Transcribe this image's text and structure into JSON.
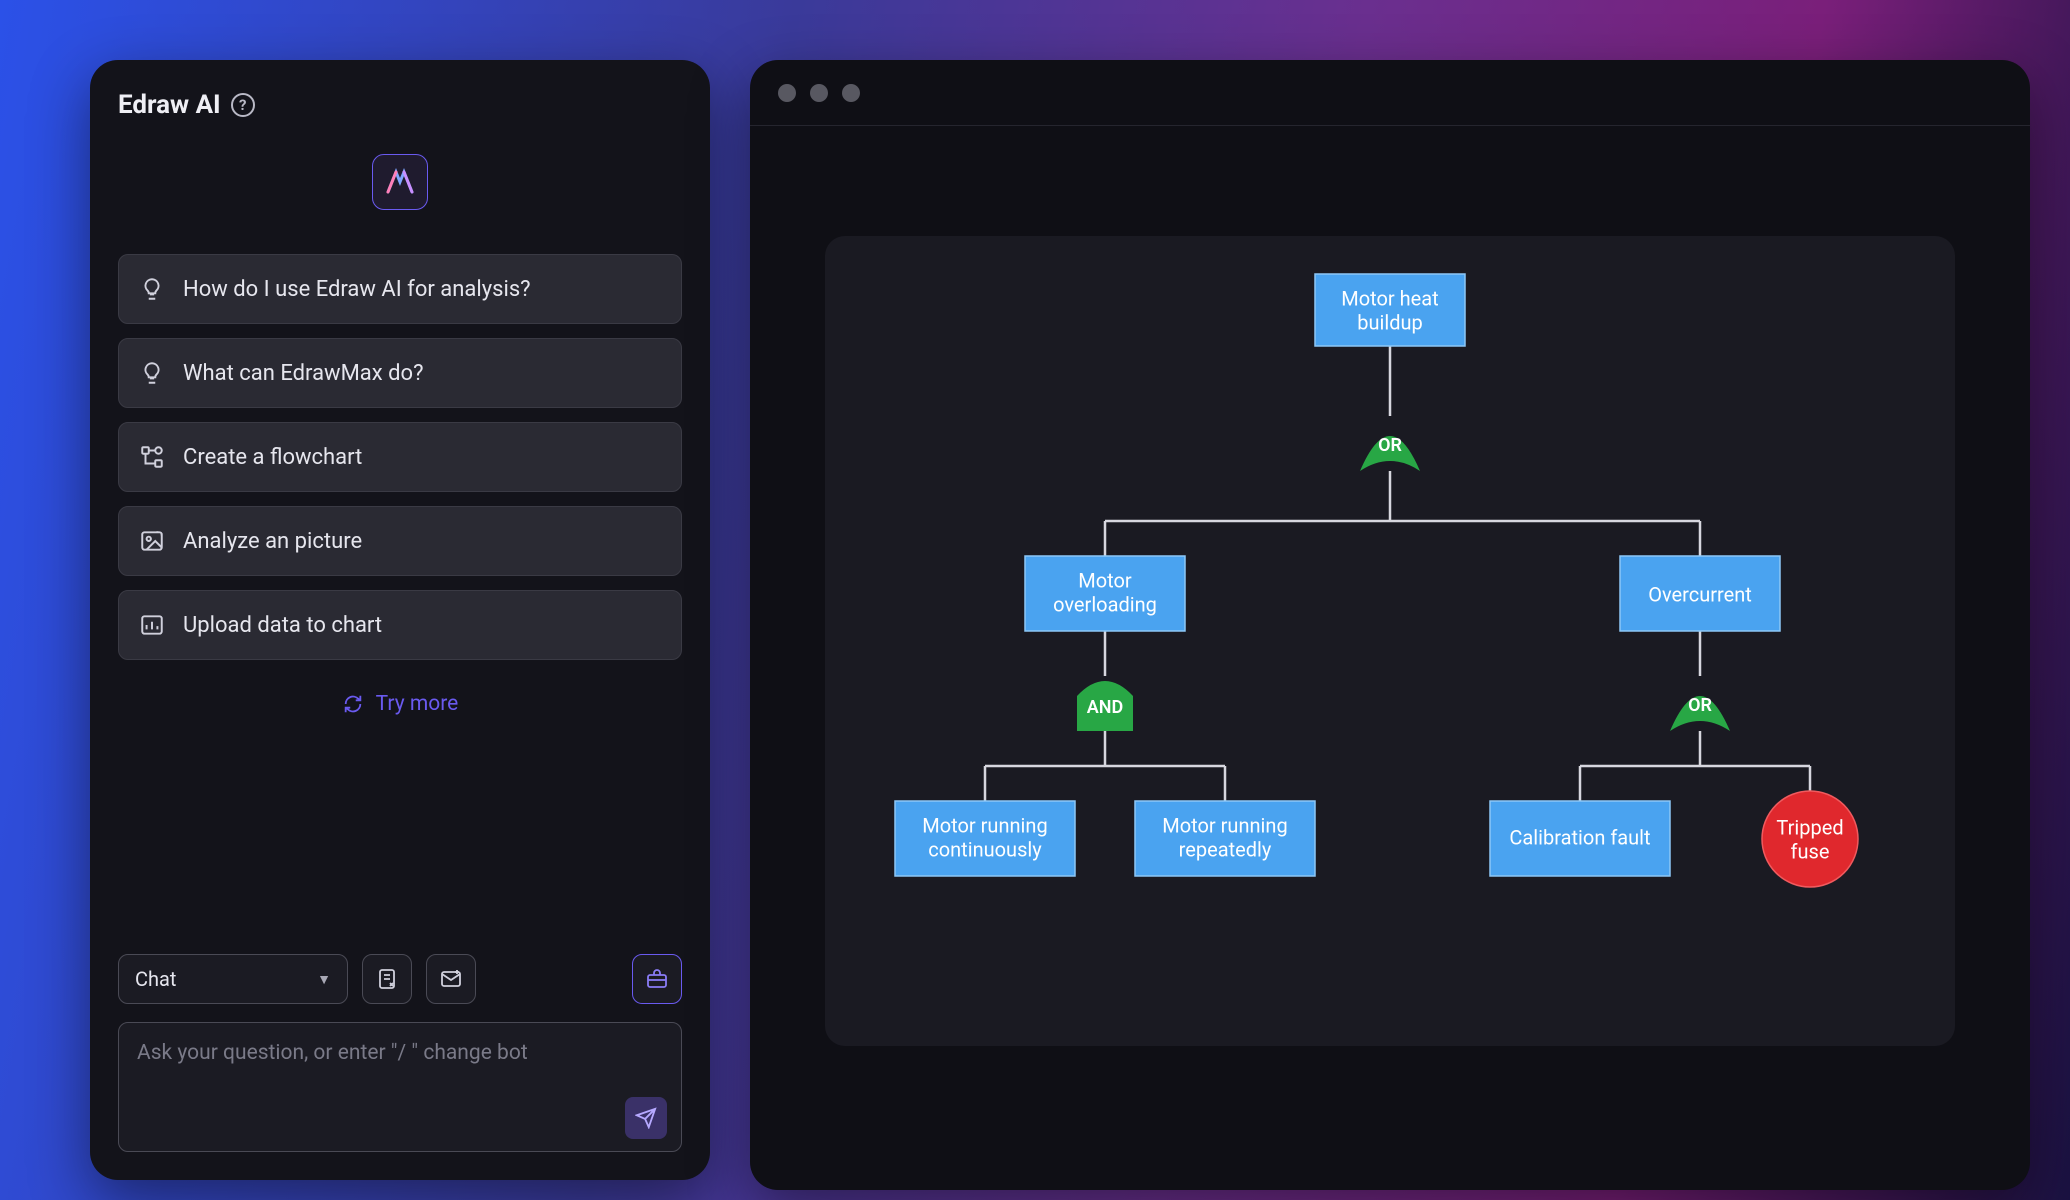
{
  "sidebar": {
    "title": "Edraw AI",
    "suggestions": [
      {
        "icon": "bulb",
        "label": "How do I use Edraw AI for analysis?"
      },
      {
        "icon": "bulb",
        "label": "What can EdrawMax do?"
      },
      {
        "icon": "flow",
        "label": "Create a flowchart"
      },
      {
        "icon": "image",
        "label": "Analyze an picture"
      },
      {
        "icon": "chart",
        "label": "Upload data to chart"
      }
    ],
    "try_more": "Try more",
    "mode": "Chat",
    "placeholder": "Ask your question, or enter   \"/  \" change bot"
  },
  "diagram": {
    "top": "Motor heat buildup",
    "or1": "OR",
    "left": "Motor overloading",
    "right": "Overcurrent",
    "and": "AND",
    "or2": "OR",
    "l1a": "Motor running",
    "l1b": "continuously",
    "l2a": "Motor running",
    "l2b": "repeatedly",
    "r1": "Calibration fault",
    "r2a": "Tripped",
    "r2b": "fuse"
  }
}
